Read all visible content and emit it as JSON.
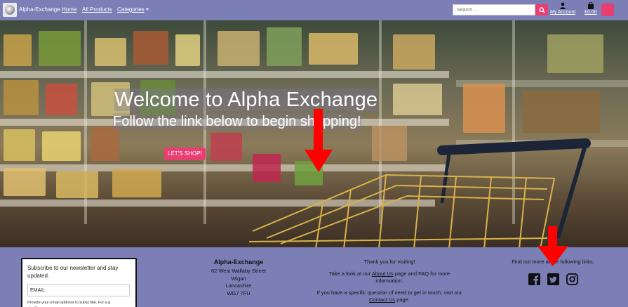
{
  "navbar": {
    "brand": "Alpha-Exchange",
    "links": [
      "Home",
      "All Products",
      "Categories"
    ],
    "search_placeholder": "Search ...",
    "account_label": "My Account",
    "cart_label": "£0.00"
  },
  "hero": {
    "title": "Welcome to Alpha Exchange",
    "subtitle": "Follow the link below to begin shopping!",
    "button_label": "LET'S SHOP!"
  },
  "footer": {
    "newsletter": {
      "text": "Subscribe to our newsletter and stay updated.",
      "input_value": "EMAIL",
      "help": "Provide your email address to subscribe. For e.g abc@xyz.com"
    },
    "address": {
      "title": "Alpha-Exchange",
      "lines": [
        "62 West Wallaby Street",
        "Wigan",
        "Lancashire",
        "WG7 7FU"
      ]
    },
    "thanks": {
      "line1": "Thank you for visiting!",
      "line2_pre": "Take a look at our ",
      "about_link": "About Us",
      "line2_post": " page and FAQ for more information.",
      "line3_pre": "If you have a specific question of need to get in touch, visit our ",
      "contact_link": "Contact Us",
      "line3_post": " page."
    },
    "social": {
      "text": "Find out more at the following links:",
      "icons": [
        "facebook-icon",
        "twitter-icon",
        "instagram-icon"
      ]
    }
  },
  "colors": {
    "navbar_bg": "#7b7fb6",
    "accent": "#e83e72",
    "arrow": "#ff0000"
  }
}
